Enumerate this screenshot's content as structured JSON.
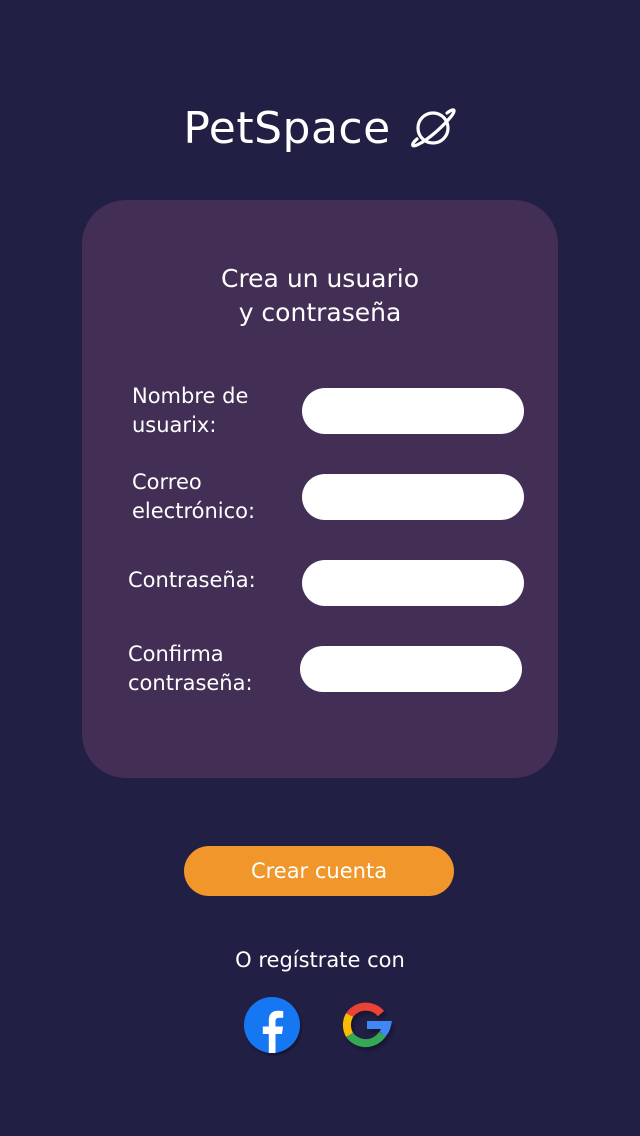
{
  "brand": {
    "title": "PetSpace",
    "icon": "planet-icon"
  },
  "form": {
    "title_line1": "Crea un usuario",
    "title_line2": "y contraseña",
    "fields": [
      {
        "label_line1": "Nombre de",
        "label_line2": "usuarix:",
        "value": "",
        "type": "text"
      },
      {
        "label_line1": "Correo",
        "label_line2": "electrónico:",
        "value": "",
        "type": "email"
      },
      {
        "label_line1": "Contraseña:",
        "label_line2": "",
        "value": "",
        "type": "password"
      },
      {
        "label_line1": "Confirma",
        "label_line2": "contraseña:",
        "value": "",
        "type": "password"
      }
    ]
  },
  "actions": {
    "create_label": "Crear cuenta"
  },
  "social": {
    "prompt": "O regístrate con",
    "providers": [
      {
        "name": "facebook",
        "icon": "facebook-icon"
      },
      {
        "name": "google",
        "icon": "google-icon"
      }
    ]
  },
  "colors": {
    "background": "#211f44",
    "card": "#432e55",
    "accent": "#f0962a",
    "input": "#ffffff",
    "text": "#ffffff"
  }
}
